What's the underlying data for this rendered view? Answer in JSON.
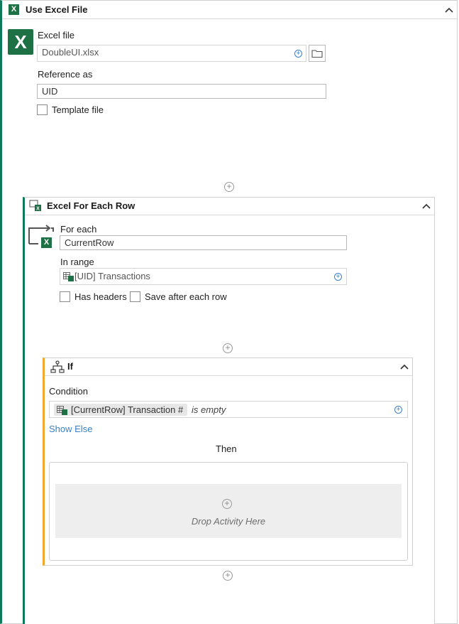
{
  "use_excel": {
    "title": "Use Excel File",
    "excel_file_label": "Excel file",
    "excel_file_value": "DoubleUI.xlsx",
    "reference_label": "Reference as",
    "reference_value": "UID",
    "template_label": "Template file",
    "template_checked": false
  },
  "for_each_row": {
    "title": "Excel For Each Row",
    "for_each_label": "For each",
    "for_each_value": "CurrentRow",
    "in_range_label": "In range",
    "in_range_value": "[UID] Transactions",
    "has_headers_label": "Has headers",
    "has_headers_checked": false,
    "save_after_label": "Save after each row",
    "save_after_checked": false
  },
  "if_activity": {
    "title": "If",
    "condition_label": "Condition",
    "condition_field": "[CurrentRow] Transaction #",
    "condition_operator": "is empty",
    "show_else": "Show Else",
    "then_label": "Then",
    "drop_placeholder": "Drop Activity Here"
  },
  "colors": {
    "excel_green": "#1e7145",
    "accent_green": "#0e7a5a",
    "if_accent": "#f0a830",
    "link_blue": "#3b82c4"
  }
}
